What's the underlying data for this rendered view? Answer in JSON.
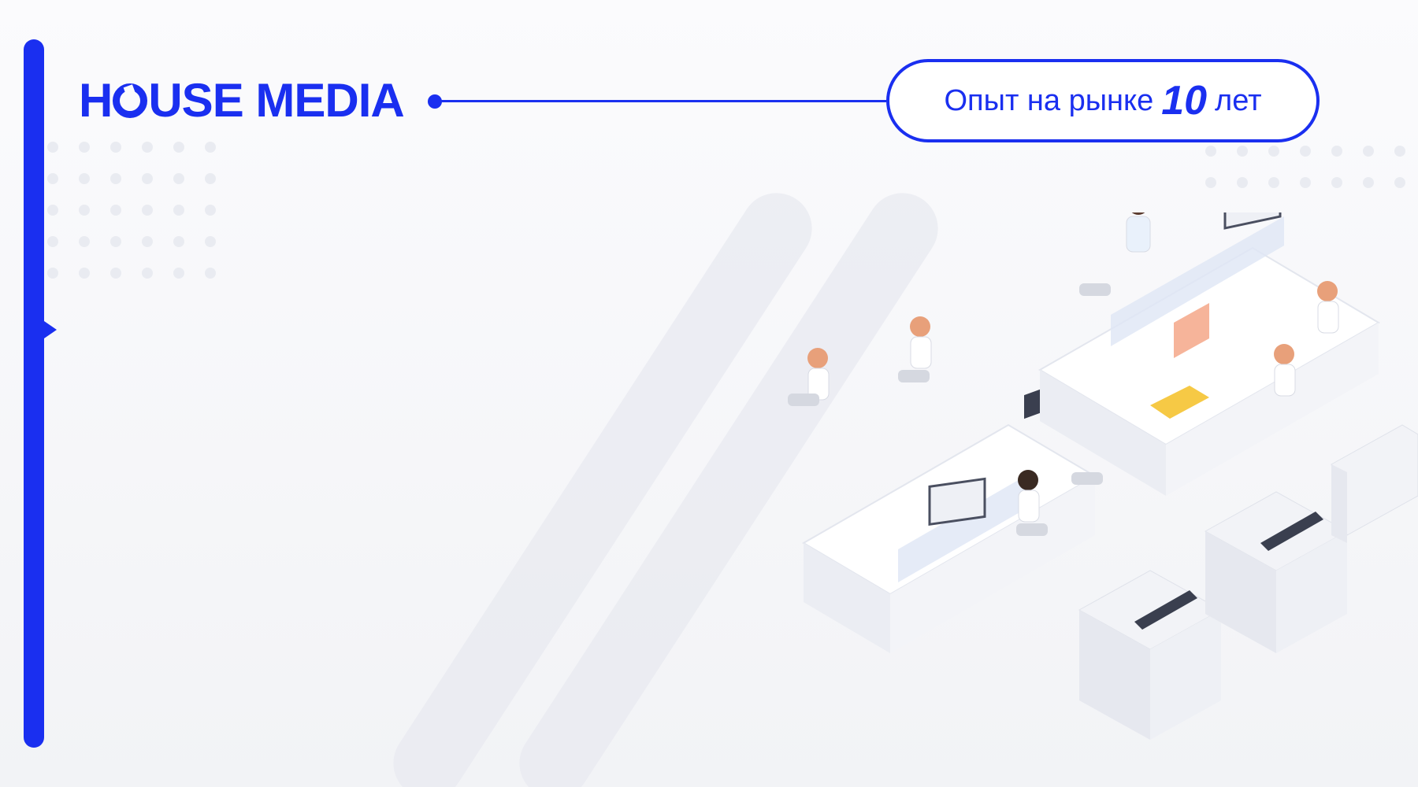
{
  "brand": {
    "logo_text_left": "H",
    "logo_text_right": "USE MEDIA",
    "color": "#1a2ff0"
  },
  "badge": {
    "prefix": "Опыт на рынке",
    "number": "10",
    "suffix": "лет"
  },
  "illustration": {
    "subject": "isometric open office with people at desks and printers"
  }
}
